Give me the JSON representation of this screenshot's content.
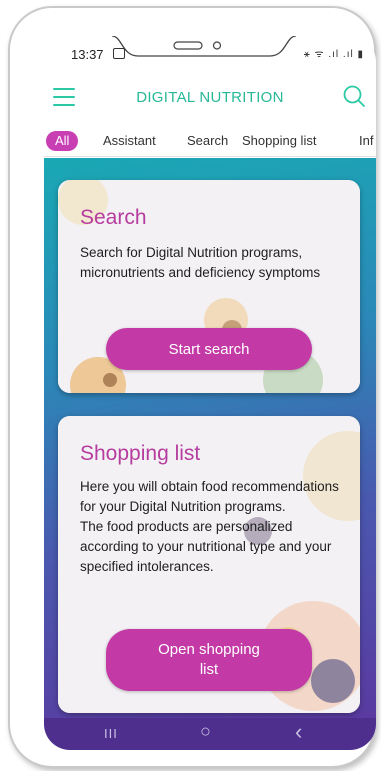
{
  "status_bar": {
    "time": "13:37",
    "signal": "⚹ ᯤ .ıl .ıl ▮"
  },
  "header": {
    "title": "DIGITAL NUTRITION"
  },
  "tabs": [
    {
      "label": "All",
      "active": true
    },
    {
      "label": "Assistant",
      "active": false
    },
    {
      "label": "Search",
      "active": false
    },
    {
      "label": "Shopping list",
      "active": false
    },
    {
      "label": "Inf",
      "active": false
    }
  ],
  "cards": {
    "search": {
      "title": "Search",
      "text": "Search for Digital Nutrition programs, micronutrients and deficiency symptoms",
      "button": "Start search"
    },
    "shopping": {
      "title": "Shopping list",
      "text_line1": "Here you will obtain food recommendations for your Digital Nutrition programs.",
      "text_line2": "The food products are personalized according to your nutritional type and your specified intolerances.",
      "button": "Open shopping list"
    }
  },
  "colors": {
    "accent": "#c33aa6",
    "brand": "#27b898"
  },
  "nav": {
    "recents": "III",
    "home": "○",
    "back": "‹"
  }
}
